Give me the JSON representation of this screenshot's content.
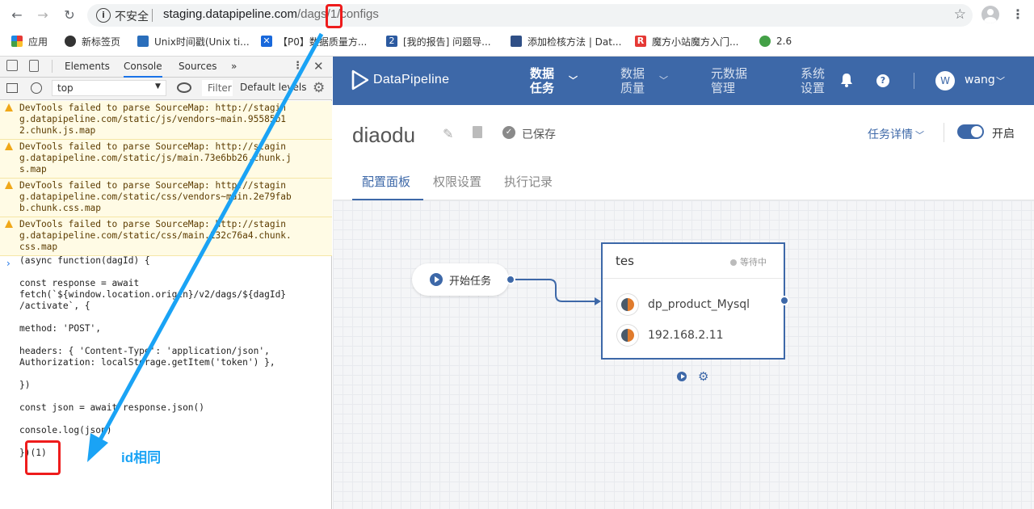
{
  "browser": {
    "security_label": "不安全",
    "url_host": "staging.datapipeline.com",
    "url_path_1": "/dags/",
    "url_id": "1",
    "url_path_2": "/configs",
    "bookmarks": [
      {
        "label": "应用",
        "icon": "apps-grid-icon"
      },
      {
        "label": "新标签页",
        "icon": "globe-icon"
      },
      {
        "label": "Unix时间戳(Unix ti...",
        "icon": "clock-icon"
      },
      {
        "label": "【P0】数据质量方...",
        "icon": "confluence-icon"
      },
      {
        "label": "[我的报告] 问题导...",
        "icon": "jira-icon"
      },
      {
        "label": "添加检核方法 | Dat...",
        "icon": "datapipeline-icon"
      },
      {
        "label": "魔方小站魔方入门...",
        "icon": "r-letter-icon"
      },
      {
        "label": "2.6",
        "icon": "cloud-icon"
      }
    ]
  },
  "devtools": {
    "tabs": [
      "Elements",
      "Console",
      "Sources",
      "»"
    ],
    "active_tab": "Console",
    "context": "top",
    "filter_placeholder": "Filter",
    "levels": "Default levels",
    "messages": [
      {
        "lines": [
          "DevTools failed to parse SourceMap: http://stagin",
          "g.datapipeline.com/static/js/vendors~main.95585b1",
          "2.chunk.js.map"
        ]
      },
      {
        "lines": [
          "DevTools failed to parse SourceMap: http://stagin",
          "g.datapipeline.com/static/js/main.73e6bb26.chunk.j",
          "s.map"
        ]
      },
      {
        "lines": [
          "DevTools failed to parse SourceMap: http://stagin",
          "g.datapipeline.com/static/css/vendors~main.2e79fab",
          "b.chunk.css.map"
        ]
      },
      {
        "lines": [
          "DevTools failed to parse SourceMap: http://stagin",
          "g.datapipeline.com/static/css/main.132c76a4.chunk.",
          "css.map"
        ]
      }
    ],
    "code_lines": [
      "(async function(dagId) {",
      "",
      "const response = await",
      "fetch(`${window.location.origin}/v2/dags/${dagId}",
      "/activate`, {",
      "",
      "method: 'POST',",
      "",
      "headers: { 'Content-Type': 'application/json',",
      "Authorization: localStorage.getItem('token') },",
      "",
      "})",
      "",
      "const json = await response.json()",
      "",
      "console.log(json)",
      "",
      "})(1)"
    ]
  },
  "app": {
    "brand": "DataPipeline",
    "menus": [
      {
        "label": "数据\n任务",
        "active": true
      },
      {
        "label": "数据\n质量",
        "active": false
      },
      {
        "label": "元数据\n管理",
        "active": false
      },
      {
        "label": "系统\n设置",
        "active": false
      }
    ],
    "user_initial": "W",
    "user_name": "wang",
    "task_title": "diaodu",
    "saved_status": "已保存",
    "task_details": "任务详情",
    "toggle_label": "开启",
    "tabs": [
      "配置面板",
      "权限设置",
      "执行记录"
    ],
    "active_tab": "配置面板",
    "start_node": "开始任务",
    "node": {
      "title": "tes",
      "status": "等待中",
      "sources": [
        "dp_product_Mysql",
        "192.168.2.11"
      ]
    }
  },
  "annotation": {
    "text": "id相同",
    "color": "#1aa3f5",
    "highlight_color": "#ee1c1c"
  },
  "colors": {
    "brand_blue": "#3d68a8",
    "warning_bg": "#fffbe5"
  }
}
